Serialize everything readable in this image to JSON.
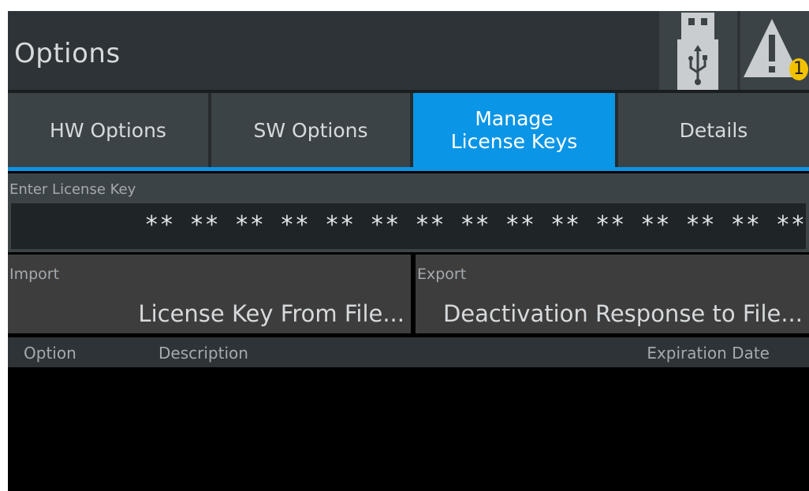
{
  "header": {
    "title": "Options",
    "warning_count": "1"
  },
  "tabs": [
    {
      "label": "HW Options",
      "active": false
    },
    {
      "label": "SW Options",
      "active": false
    },
    {
      "label": "Manage\nLicense Keys",
      "active": true
    },
    {
      "label": "Details",
      "active": false
    }
  ],
  "license_key": {
    "label": "Enter License Key",
    "value": "** ** ** ** ** ** ** ** ** ** ** ** ** ** **"
  },
  "import": {
    "label": "Import",
    "value": "License Key From File..."
  },
  "export": {
    "label": "Export",
    "value": "Deactivation Response to File..."
  },
  "table": {
    "columns": [
      "Option",
      "Description",
      "Expiration Date"
    ],
    "rows": []
  },
  "colors": {
    "accent": "#0a95e6",
    "titlebar": "#2d3337",
    "panel": "#3c4347",
    "warning": "#f2c200"
  },
  "icons": {
    "usb": "usb-stick-icon",
    "warning": "warning-triangle-icon"
  }
}
